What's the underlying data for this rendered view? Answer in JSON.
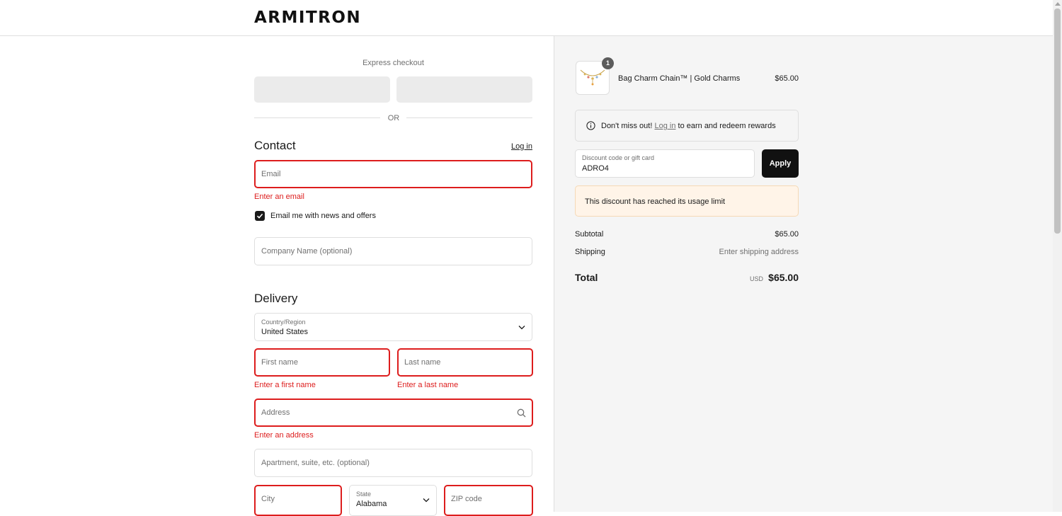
{
  "header": {
    "logo": "ARMITRON"
  },
  "express": {
    "label": "Express checkout",
    "or": "OR"
  },
  "contact": {
    "title": "Contact",
    "login_link": "Log in",
    "email_placeholder": "Email",
    "email_error": "Enter an email",
    "newsletter_label": "Email me with news and offers",
    "newsletter_checked": true,
    "company_placeholder": "Company Name (optional)"
  },
  "delivery": {
    "title": "Delivery",
    "country_label": "Country/Region",
    "country_value": "United States",
    "first_name_placeholder": "First name",
    "first_name_error": "Enter a first name",
    "last_name_placeholder": "Last name",
    "last_name_error": "Enter a last name",
    "address_placeholder": "Address",
    "address_error": "Enter an address",
    "apartment_placeholder": "Apartment, suite, etc. (optional)",
    "city_placeholder": "City",
    "state_label": "State",
    "state_value": "Alabama",
    "zip_placeholder": "ZIP code"
  },
  "order": {
    "item": {
      "name": "Bag Charm Chain™ | Gold Charms",
      "price": "$65.00",
      "quantity": "1"
    },
    "rewards": {
      "prefix": "Don't miss out!",
      "link": "Log in",
      "suffix": "to earn and redeem rewards"
    },
    "discount": {
      "label": "Discount code or gift card",
      "value": "ADRO4",
      "apply_label": "Apply"
    },
    "notice": "This discount has reached its usage limit",
    "subtotal_label": "Subtotal",
    "subtotal_value": "$65.00",
    "shipping_label": "Shipping",
    "shipping_value": "Enter shipping address",
    "total_label": "Total",
    "currency": "USD",
    "total_value": "$65.00"
  },
  "colors": {
    "error": "#dd1d1d",
    "accent": "#111111",
    "notice_bg": "#fff4e8"
  }
}
